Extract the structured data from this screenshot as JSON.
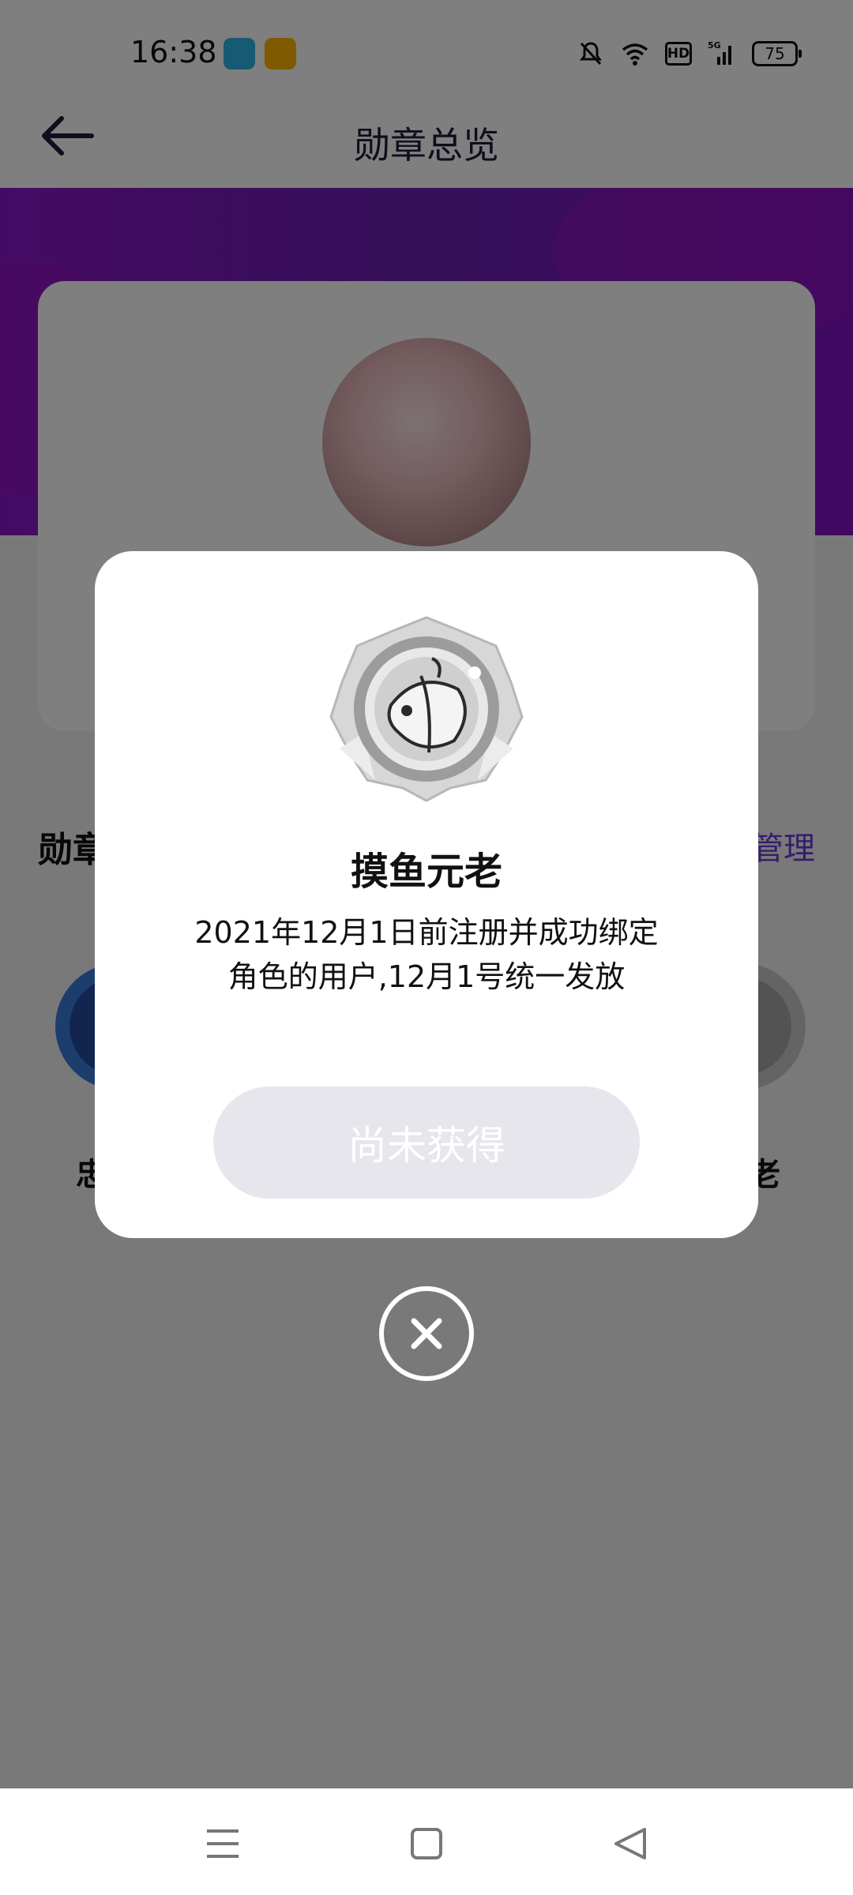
{
  "status_bar": {
    "time": "16:38",
    "hd_label": "HD",
    "network_label": "5G",
    "battery": "75"
  },
  "header": {
    "title": "勋章总览"
  },
  "background": {
    "section_title": "勋章",
    "manage_label": "管理",
    "badge_left_label": "忠",
    "badge_right_label": "老"
  },
  "modal": {
    "badge_name": "摸鱼元老",
    "description_lines": [
      "2021年12月1日前注册并成功绑定",
      "角色的用户,12月1号统一发放"
    ],
    "status_button": "尚未获得"
  },
  "icons": {
    "back": "arrow-left-icon",
    "close": "close-icon",
    "nav_menu": "menu-icon",
    "nav_home": "square-icon",
    "nav_back": "triangle-back-icon"
  },
  "colors": {
    "accent": "#6b3ad9",
    "banner": "#8a17c9",
    "button_disabled": "#e6e6ec"
  }
}
